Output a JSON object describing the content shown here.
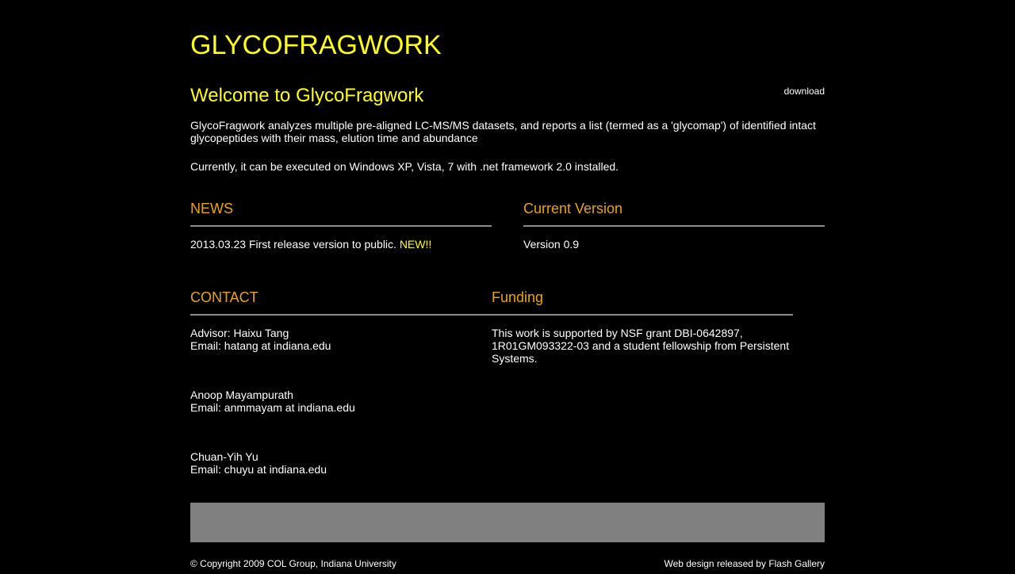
{
  "site_title": "GLYCOFRAGWORK",
  "download_label": "download",
  "welcome": {
    "title": "Welcome to GlycoFragwork",
    "paragraph1": "GlycoFragwork analyzes multiple pre-aligned LC-MS/MS datasets, and reports a list (termed as a 'glycomap') of identified intact glycopeptides with their mass, elution time and abundance",
    "paragraph2": "Currently, it can be executed on Windows XP, Vista, 7 with .net framework 2.0 installed."
  },
  "news": {
    "heading": "NEWS",
    "item_text": "2013.03.23 First release version to public. ",
    "item_badge": "NEW!!"
  },
  "version": {
    "heading": "Current Version",
    "text": "Version 0.9"
  },
  "contact": {
    "heading": "CONTACT",
    "people": [
      {
        "name": "Advisor: Haixu Tang",
        "email": "Email: hatang at indiana.edu"
      },
      {
        "name": "Anoop Mayampurath",
        "email": "Email: anmmayam at indiana.edu"
      },
      {
        "name": "Chuan-Yih Yu",
        "email": "Email: chuyu at indiana.edu"
      }
    ]
  },
  "funding": {
    "heading": "Funding",
    "text": "This work is supported by NSF grant DBI-0642897, 1R01GM093322-03 and a student fellowship from Persistent Systems."
  },
  "footer": {
    "copyright": "© Copyright 2009 COL Group, Indiana University",
    "design_credit": "Web design released by Flash Gallery"
  },
  "colors": {
    "background": "#000000",
    "title_yellow": "#ffff1a",
    "section_orange": "#e8a317",
    "rule_gray": "#8c8c8c",
    "footer_bar_gray": "#808080"
  }
}
